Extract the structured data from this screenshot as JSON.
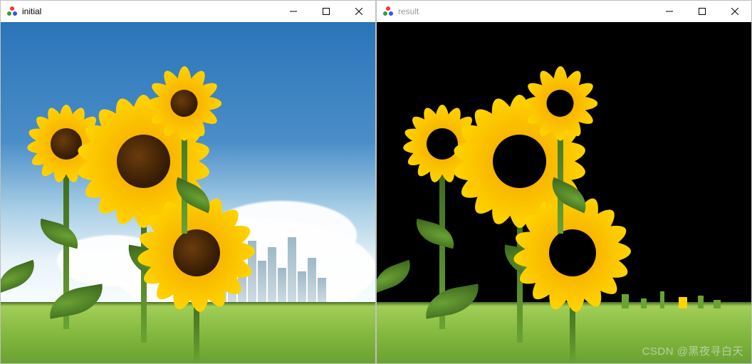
{
  "windows": [
    {
      "id": "initial",
      "title": "initial",
      "active": true
    },
    {
      "id": "result",
      "title": "result",
      "active": false
    }
  ],
  "watermark": "CSDN @黑夜寻白天",
  "icons": {
    "app": "opencv-icon",
    "minimize": "minimize-icon",
    "maximize": "maximize-icon",
    "close": "close-icon"
  }
}
